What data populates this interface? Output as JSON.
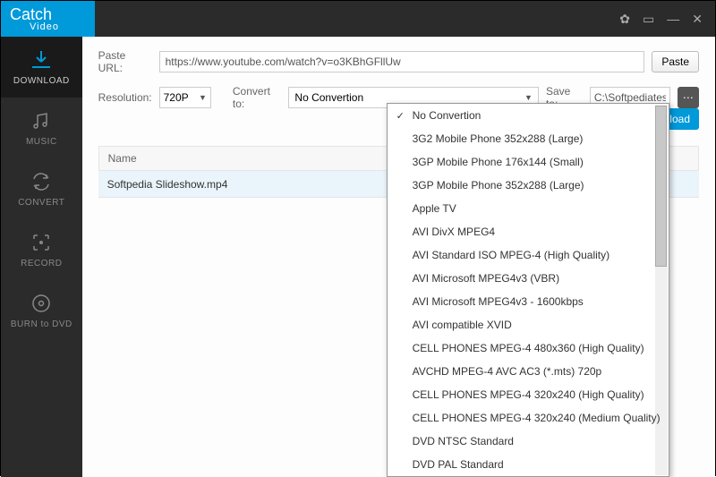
{
  "app": {
    "name": "Catch",
    "subtitle": "Video"
  },
  "sidebar": {
    "items": [
      {
        "label": "DOWNLOAD"
      },
      {
        "label": "MUSIC"
      },
      {
        "label": "CONVERT"
      },
      {
        "label": "RECORD"
      },
      {
        "label": "BURN to DVD"
      }
    ]
  },
  "toolbar": {
    "paste_url_label": "Paste URL:",
    "url_value": "https://www.youtube.com/watch?v=o3KBhGFllUw",
    "paste_btn": "Paste",
    "resolution_label": "Resolution:",
    "resolution_value": "720P",
    "convert_label": "Convert to:",
    "convert_value": "No Convertion",
    "saveto_label": "Save to:",
    "saveto_value": "C:\\Softpediatest\\",
    "download_btn": "Download"
  },
  "table": {
    "header_name": "Name",
    "rows": [
      {
        "name": "Softpedia Slideshow.mp4"
      }
    ]
  },
  "dropdown": {
    "items": [
      "No Convertion",
      "3G2 Mobile Phone 352x288 (Large)",
      "3GP Mobile Phone 176x144 (Small)",
      "3GP Mobile Phone 352x288 (Large)",
      "Apple TV",
      "AVI DivX MPEG4",
      "AVI Standard ISO MPEG-4 (High Quality)",
      "AVI Microsoft MPEG4v3 (VBR)",
      "AVI Microsoft MPEG4v3 - 1600kbps",
      "AVI compatible XVID",
      "CELL PHONES MPEG-4 480x360 (High Quality)",
      "AVCHD MPEG-4 AVC AC3 (*.mts) 720p",
      "CELL PHONES MPEG-4 320x240 (High Quality)",
      "CELL PHONES MPEG-4 320x240 (Medium Quality)",
      "DVD NTSC Standard",
      "DVD PAL Standard"
    ]
  }
}
